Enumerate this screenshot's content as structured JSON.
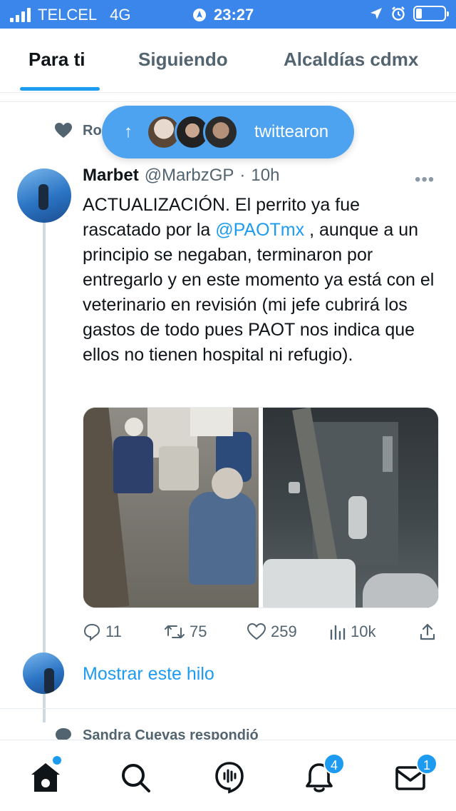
{
  "status_bar": {
    "carrier": "TELCEL",
    "network": "4G",
    "time": "23:27"
  },
  "tabs": [
    {
      "label": "Para ti",
      "active": true
    },
    {
      "label": "Siguiendo",
      "active": false
    },
    {
      "label": "Alcaldías cdmx",
      "active": false
    }
  ],
  "new_tweets_pill": {
    "label": "twittearon"
  },
  "context_row": {
    "text": "Ro                                                                                          inez ind"
  },
  "tweet": {
    "author_name": "Marbet",
    "handle": "@MarbzGP",
    "separator": "·",
    "time": "10h",
    "text_before_mention": "ACTUALIZACIÓN. El perrito ya fue rascatado por la ",
    "mention": "@PAOTmx",
    "text_after_mention": " , aunque a un principio se negaban, terminaron por entregarlo y en este momento ya está con el veterinario en revisión (mi jefe cubrirá los gastos de todo pues PAOT nos indica que ellos no tienen hospital ni refugio).",
    "replies": "11",
    "retweets": "75",
    "likes": "259",
    "views": "10k"
  },
  "show_thread": "Mostrar este hilo",
  "next_context": "Sandra Cuevas respondió",
  "bottom_nav": {
    "notifications_badge": "4",
    "messages_badge": "1"
  },
  "colors": {
    "accent": "#1d9bf0",
    "status_bar": "#3a86ea"
  }
}
